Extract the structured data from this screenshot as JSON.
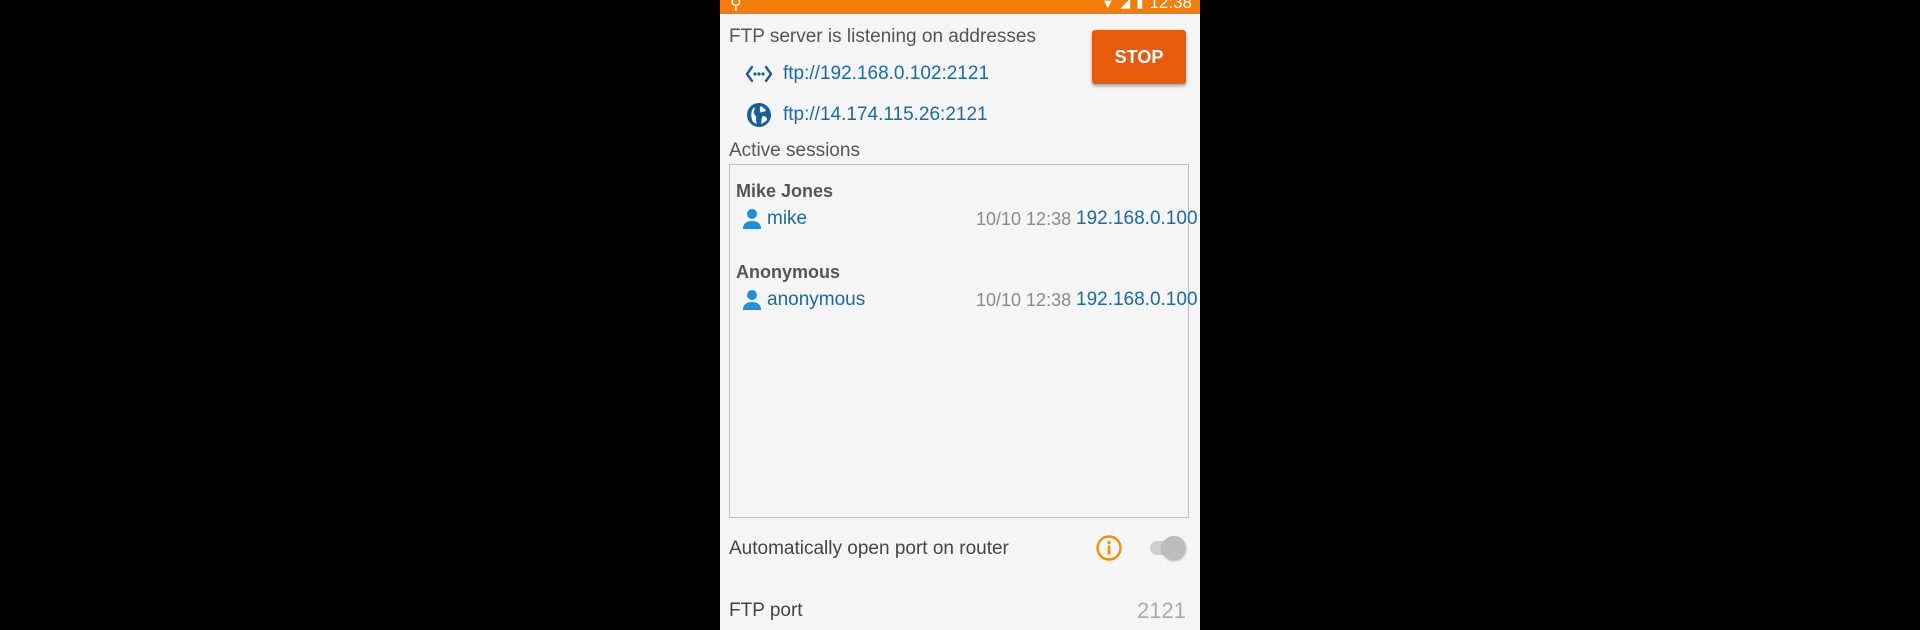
{
  "status_bar": {
    "time": "12:38",
    "color": "#f47c0b"
  },
  "server": {
    "listening_title": "FTP server is listening on addresses",
    "stop_label": "STOP",
    "local_address": "ftp://192.168.0.102:2121",
    "public_address": "ftp://14.174.115.26:2121",
    "local_icon": "network-code-icon",
    "public_icon": "globe-icon"
  },
  "sessions": {
    "title": "Active sessions",
    "items": [
      {
        "name": "Mike Jones",
        "user": "mike",
        "time": "10/10 12:38",
        "ip": "192.168.0.100"
      },
      {
        "name": "Anonymous",
        "user": "anonymous",
        "time": "10/10 12:38",
        "ip": "192.168.0.100"
      }
    ]
  },
  "settings": {
    "auto_port_label": "Automatically open port on router",
    "auto_port_enabled": false,
    "ftp_port_label": "FTP port",
    "ftp_port_value": "2121"
  },
  "colors": {
    "accent": "#e85a0c",
    "link": "#1a6aa3",
    "info_icon": "#f0900f"
  }
}
